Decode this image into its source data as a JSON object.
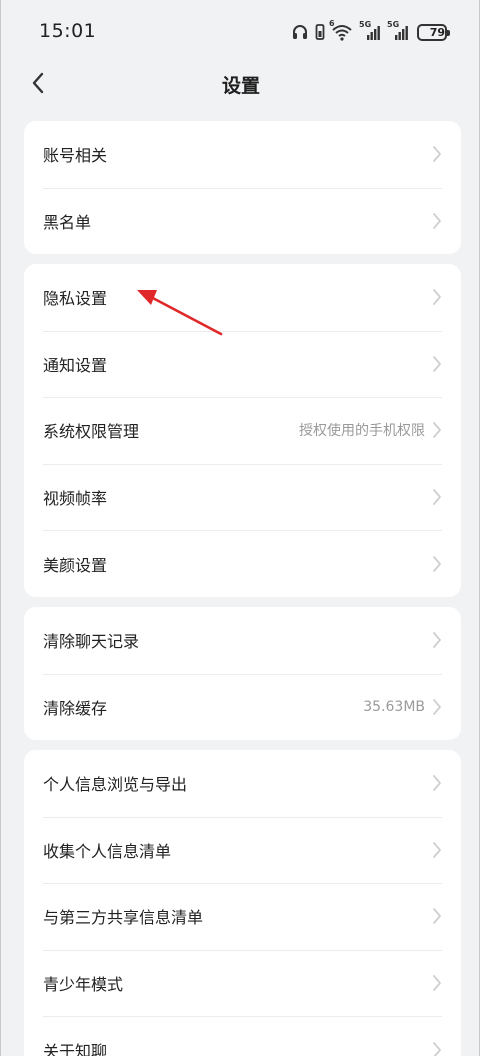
{
  "status_bar": {
    "time": "15:01",
    "battery": "79",
    "battery_level": 0.79,
    "signal_label_1": "5G",
    "signal_label_2": "5G",
    "wifi_badge": "6",
    "icons": [
      "headphones-icon",
      "vibrate-icon",
      "wifi-icon",
      "signal-5g-icon",
      "signal-5g-icon",
      "battery-icon"
    ]
  },
  "header": {
    "title": "设置",
    "back_icon": "chevron-left-icon"
  },
  "groups": [
    {
      "items": [
        {
          "label": "账号相关",
          "value": ""
        },
        {
          "label": "黑名单",
          "value": ""
        }
      ]
    },
    {
      "items": [
        {
          "label": "隐私设置",
          "value": ""
        },
        {
          "label": "通知设置",
          "value": ""
        },
        {
          "label": "系统权限管理",
          "value": "授权使用的手机权限"
        },
        {
          "label": "视频帧率",
          "value": ""
        },
        {
          "label": "美颜设置",
          "value": ""
        }
      ]
    },
    {
      "items": [
        {
          "label": "清除聊天记录",
          "value": ""
        },
        {
          "label": "清除缓存",
          "value": "35.63MB"
        }
      ]
    },
    {
      "items": [
        {
          "label": "个人信息浏览与导出",
          "value": ""
        },
        {
          "label": "收集个人信息清单",
          "value": ""
        },
        {
          "label": "与第三方共享信息清单",
          "value": ""
        },
        {
          "label": "青少年模式",
          "value": ""
        },
        {
          "label": "关于知聊",
          "value": ""
        }
      ]
    }
  ],
  "colors": {
    "background": "#f1f2f4",
    "card": "#ffffff",
    "annotation_arrow": "#e02828",
    "secondary_text": "#9a9a9a"
  }
}
